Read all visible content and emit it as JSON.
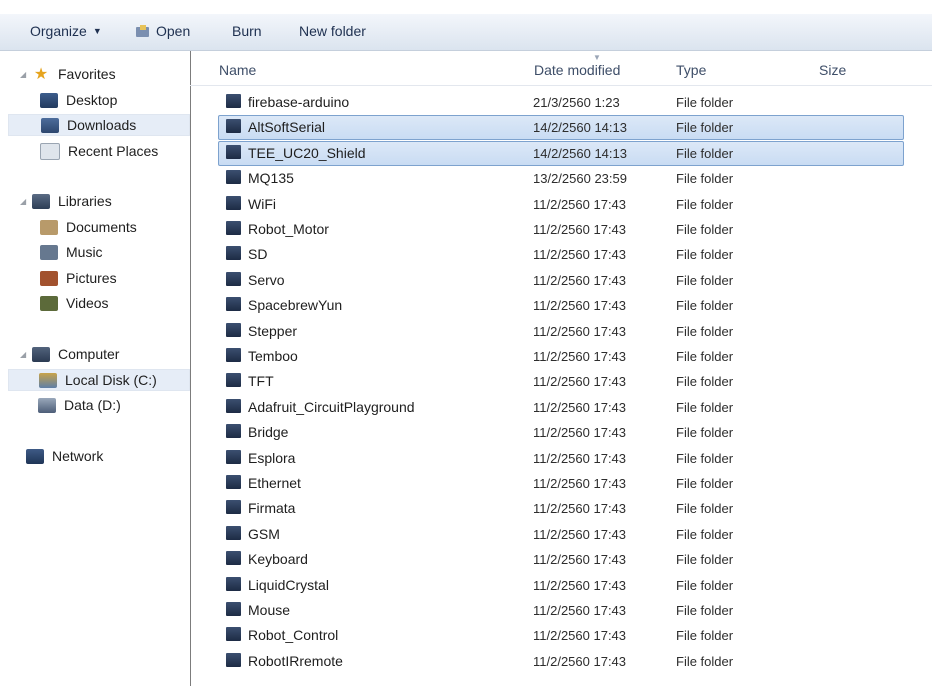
{
  "toolbar": {
    "organize_label": "Organize",
    "open_label": "Open",
    "burn_label": "Burn",
    "new_folder_label": "New folder"
  },
  "nav": {
    "favorites": "Favorites",
    "desktop": "Desktop",
    "downloads": "Downloads",
    "recent_places": "Recent Places",
    "libraries": "Libraries",
    "documents": "Documents",
    "music": "Music",
    "pictures": "Pictures",
    "videos": "Videos",
    "computer": "Computer",
    "local_disk": "Local Disk (C:)",
    "data_disk": "Data (D:)",
    "network": "Network"
  },
  "columns": {
    "name": "Name",
    "date": "Date modified",
    "type": "Type",
    "size": "Size"
  },
  "files": [
    {
      "name": "firebase-arduino",
      "date": "21/3/2560 1:23",
      "type": "File folder",
      "selected": false
    },
    {
      "name": "AltSoftSerial",
      "date": "14/2/2560 14:13",
      "type": "File folder",
      "selected": true
    },
    {
      "name": "TEE_UC20_Shield",
      "date": "14/2/2560 14:13",
      "type": "File folder",
      "selected": true
    },
    {
      "name": "MQ135",
      "date": "13/2/2560 23:59",
      "type": "File folder",
      "selected": false
    },
    {
      "name": "WiFi",
      "date": "11/2/2560 17:43",
      "type": "File folder",
      "selected": false
    },
    {
      "name": "Robot_Motor",
      "date": "11/2/2560 17:43",
      "type": "File folder",
      "selected": false
    },
    {
      "name": "SD",
      "date": "11/2/2560 17:43",
      "type": "File folder",
      "selected": false
    },
    {
      "name": "Servo",
      "date": "11/2/2560 17:43",
      "type": "File folder",
      "selected": false
    },
    {
      "name": "SpacebrewYun",
      "date": "11/2/2560 17:43",
      "type": "File folder",
      "selected": false
    },
    {
      "name": "Stepper",
      "date": "11/2/2560 17:43",
      "type": "File folder",
      "selected": false
    },
    {
      "name": "Temboo",
      "date": "11/2/2560 17:43",
      "type": "File folder",
      "selected": false
    },
    {
      "name": "TFT",
      "date": "11/2/2560 17:43",
      "type": "File folder",
      "selected": false
    },
    {
      "name": "Adafruit_CircuitPlayground",
      "date": "11/2/2560 17:43",
      "type": "File folder",
      "selected": false
    },
    {
      "name": "Bridge",
      "date": "11/2/2560 17:43",
      "type": "File folder",
      "selected": false
    },
    {
      "name": "Esplora",
      "date": "11/2/2560 17:43",
      "type": "File folder",
      "selected": false
    },
    {
      "name": "Ethernet",
      "date": "11/2/2560 17:43",
      "type": "File folder",
      "selected": false
    },
    {
      "name": "Firmata",
      "date": "11/2/2560 17:43",
      "type": "File folder",
      "selected": false
    },
    {
      "name": "GSM",
      "date": "11/2/2560 17:43",
      "type": "File folder",
      "selected": false
    },
    {
      "name": "Keyboard",
      "date": "11/2/2560 17:43",
      "type": "File folder",
      "selected": false
    },
    {
      "name": "LiquidCrystal",
      "date": "11/2/2560 17:43",
      "type": "File folder",
      "selected": false
    },
    {
      "name": "Mouse",
      "date": "11/2/2560 17:43",
      "type": "File folder",
      "selected": false
    },
    {
      "name": "Robot_Control",
      "date": "11/2/2560 17:43",
      "type": "File folder",
      "selected": false
    },
    {
      "name": "RobotIRremote",
      "date": "11/2/2560 17:43",
      "type": "File folder",
      "selected": false
    }
  ]
}
